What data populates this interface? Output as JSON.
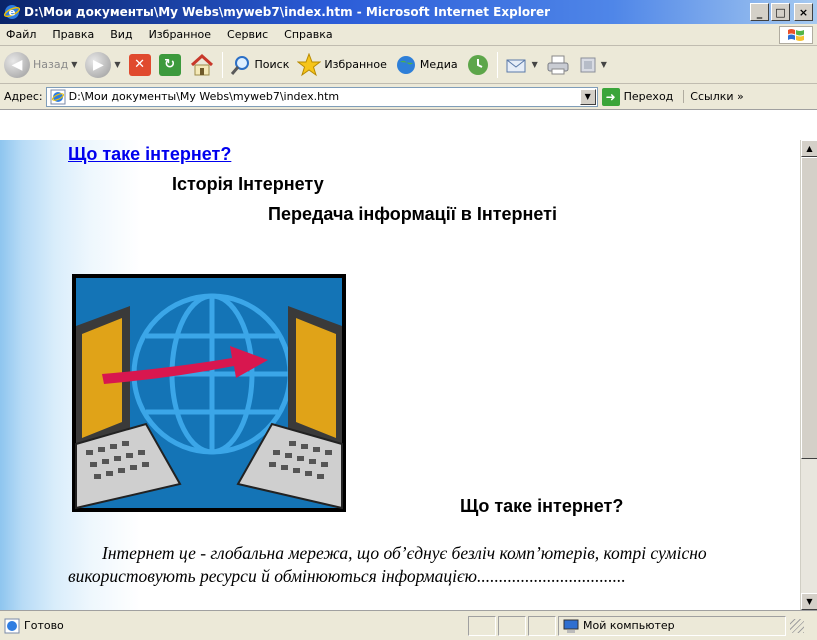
{
  "window": {
    "title": "D:\\Мои документы\\My Webs\\myweb7\\index.htm - Microsoft Internet Explorer",
    "minimize": "_",
    "maximize": "□",
    "close": "×"
  },
  "menu": [
    "Файл",
    "Правка",
    "Вид",
    "Избранное",
    "Сервис",
    "Справка"
  ],
  "toolbar": {
    "back": "Назад",
    "search": "Поиск",
    "favorites": "Избранное",
    "media": "Медиа"
  },
  "address": {
    "label": "Адрес:",
    "value": "D:\\Мои документы\\My Webs\\myweb7\\index.htm",
    "go": "Переход",
    "links": "Ссылки »"
  },
  "page": {
    "link": "Що таке інтернет?",
    "heading1": "Історія Інтернету",
    "heading2": "Передача інформації в Інтернеті",
    "heading3": "Що таке інтернет?",
    "paragraph": "Інтернет це - глобальна мережа, що об’єднує безліч комп’ютерів, котрі сумісно використовують ресурси й обмінюються інформацією.................................."
  },
  "status": {
    "text": "Готово",
    "zone": "Мой компьютер"
  },
  "colors": {
    "link": "#0000ee",
    "titlebar": "#0a246a",
    "chrome": "#ece9d8"
  }
}
